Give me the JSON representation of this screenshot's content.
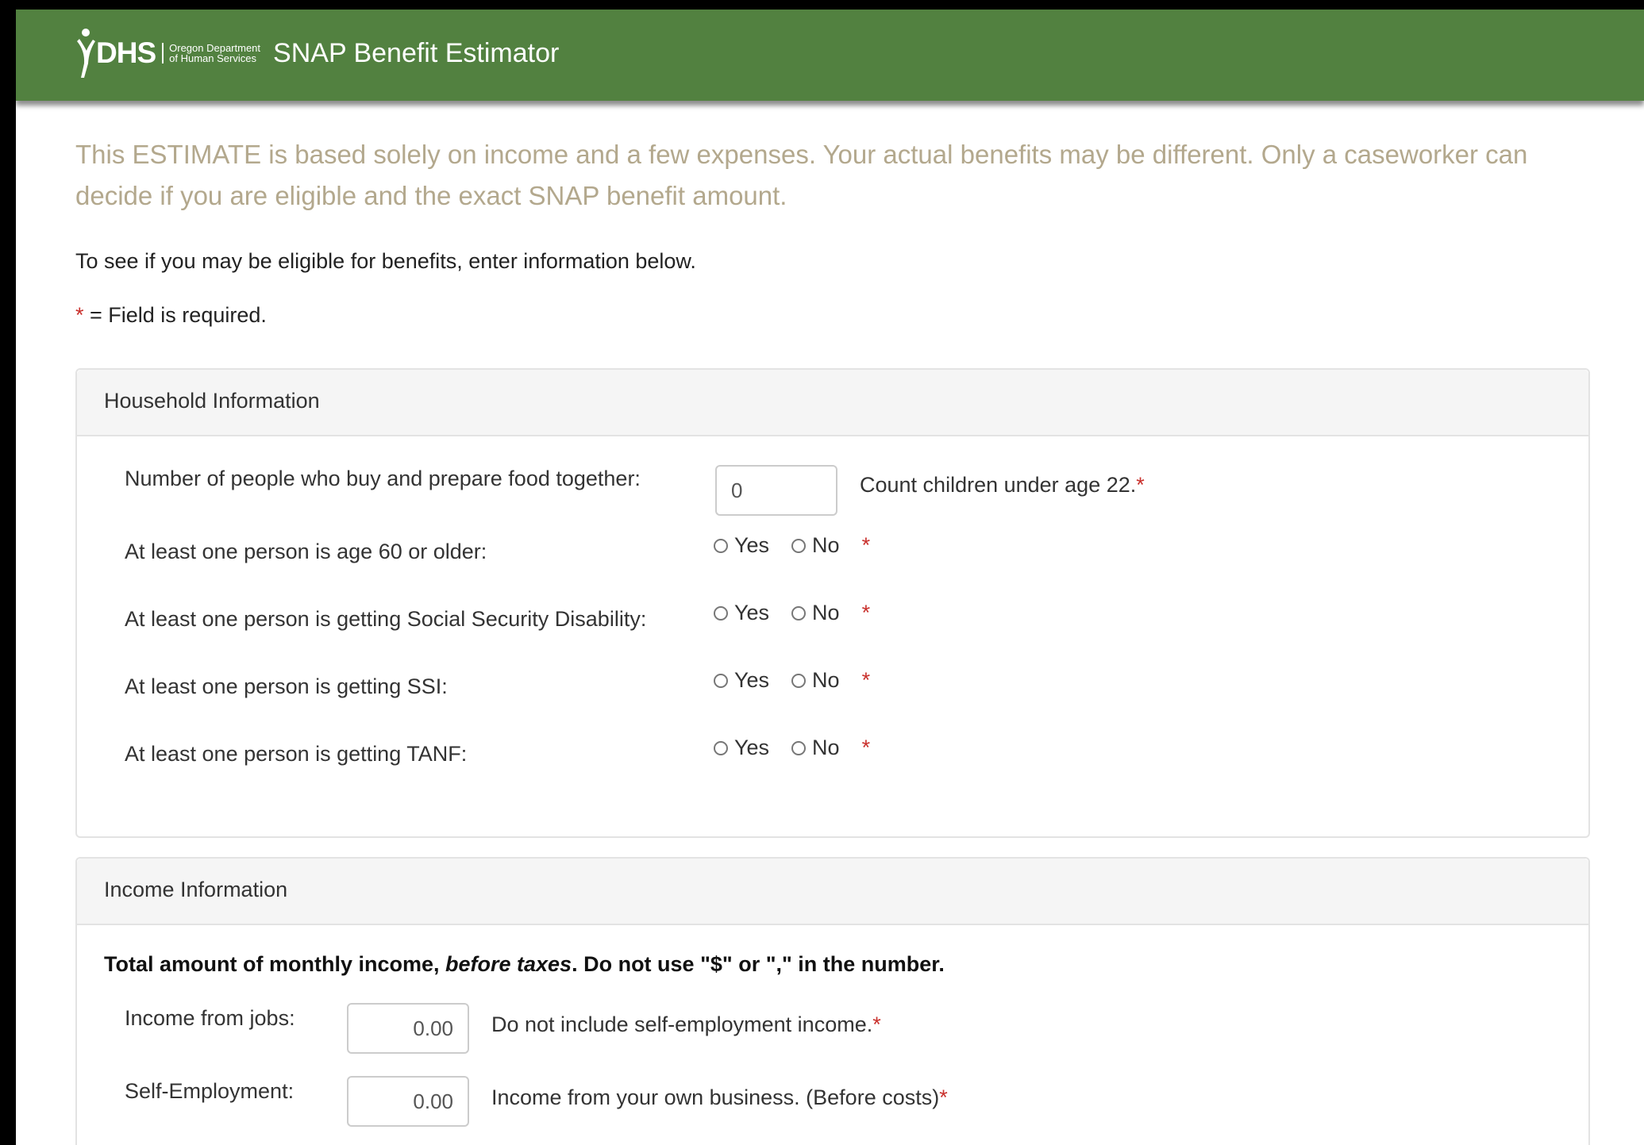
{
  "header": {
    "logo_text": "DHS",
    "logo_org_line1": "Oregon Department",
    "logo_org_line2": "of Human Services",
    "title": "SNAP Benefit Estimator"
  },
  "notice": "This ESTIMATE is based solely on income and a few expenses. Your actual benefits may be different. Only a caseworker can decide if you are eligible and the exact SNAP benefit amount.",
  "intro": "To see if you may be eligible for benefits, enter information below.",
  "required_note": {
    "star": "*",
    "text": " = Field is required."
  },
  "household": {
    "title": "Household Information",
    "people": {
      "label": "Number of people who buy and prepare food together:",
      "value": "0",
      "help": "Count children under age 22."
    },
    "questions": [
      {
        "label": "At least one person is age 60 or older:",
        "yes": "Yes",
        "no": "No"
      },
      {
        "label": "At least one person is getting Social Security Disability:",
        "yes": "Yes",
        "no": "No"
      },
      {
        "label": "At least one person is getting SSI:",
        "yes": "Yes",
        "no": "No"
      },
      {
        "label": "At least one person is getting TANF:",
        "yes": "Yes",
        "no": "No"
      }
    ]
  },
  "income": {
    "title": "Income Information",
    "instr_part1": "Total amount of monthly income, ",
    "instr_italic": "before taxes",
    "instr_part2": ". Do not use \"$\" or \",\" in the number.",
    "jobs": {
      "label": "Income from jobs:",
      "value": "0.00",
      "help": "Do not include self-employment income."
    },
    "self_employment": {
      "label": "Self-Employment:",
      "value": "0.00",
      "help": "Income from your own business. (Before costs)"
    }
  },
  "required_star": "*",
  "colors": {
    "header_green": "#528140",
    "notice_text": "#b3a88d",
    "required_red": "#c9302c"
  }
}
